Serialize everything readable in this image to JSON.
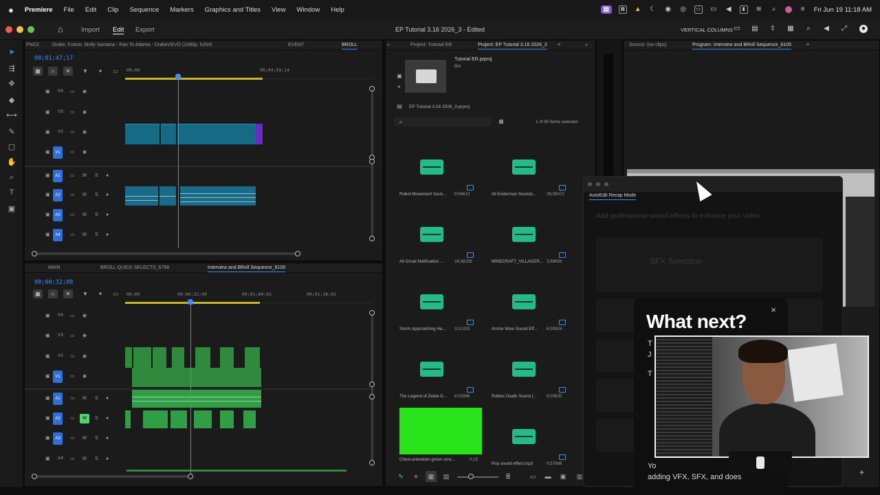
{
  "menubar": {
    "app": "Premiere",
    "items": [
      "File",
      "Edit",
      "Clip",
      "Sequence",
      "Markers",
      "Graphics and Titles",
      "View",
      "Window",
      "Help"
    ],
    "clock": "Fri Jun 19  11:18 AM"
  },
  "header": {
    "tabs": [
      "Import",
      "Edit",
      "Export"
    ],
    "active_tab": "Edit",
    "doc_title": "EP Tutorial 3.16 2026_3 - Edited",
    "workspace": "VERTICAL COLUMNS"
  },
  "top_timeline": {
    "tabs": [
      "PNG2",
      "Drake, Future, Molly Santana - Ran To Atlanta - DrakeVEVO (1080p, h264)",
      "EVENT",
      "BROLL"
    ],
    "active_tab": "BROLL",
    "timecode": "00;01;47;17",
    "ruler": [
      "00;00",
      "00;04;59;14"
    ],
    "tracks": [
      "V4",
      "V3",
      "V2",
      "V1",
      "A1",
      "A2",
      "A3",
      "A4"
    ]
  },
  "bottom_timeline": {
    "tabs": [
      "MAIN",
      "BROLL QUICK SELECTS_6758",
      "Interview and BRoll Sequence_8105"
    ],
    "active_tab": "Interview and BRoll Sequence_8105",
    "timecode": "00;00;32;00",
    "ruler": [
      "00;00",
      "00;00;32;00",
      "00;01;04;02",
      "00;01;36;02"
    ],
    "tracks": [
      "V4",
      "V3",
      "V2",
      "V1",
      "A1",
      "A2",
      "A3",
      "A4"
    ]
  },
  "project": {
    "tabs": [
      "Project: Tutorial ER",
      "Project: EP Tutorial 3.16 2026_3"
    ],
    "active_tab": "Project: EP Tutorial 3.16 2026_3",
    "bin_name": "Tutorial ER.prproj",
    "bin_type": "Bin",
    "path": "EP Tutorial 3.16 2026_3.prproj",
    "search_placeholder": "",
    "selection": "1 of 90 items selected",
    "assets": [
      {
        "name": "Robot Movement Soun...",
        "dur": "9;06612"
      },
      {
        "name": "All Enderman Sounds...",
        "dur": "26;09472"
      },
      {
        "name": "All Gmail Notification ...",
        "dur": "24;38256"
      },
      {
        "name": "MINECRAFT_VILLAGER...",
        "dur": "3;98656"
      },
      {
        "name": "Storm Approaching Ha...",
        "dur": "3;11328"
      },
      {
        "name": "Anime Wow Sound Eff...",
        "dur": "6;00824"
      },
      {
        "name": "The Legend of Zelda O...",
        "dur": "6;02866"
      },
      {
        "name": "Roblox Death Sound (...",
        "dur": "6;00830"
      },
      {
        "name": "Chest animation green scre...",
        "dur": "0;15"
      },
      {
        "name": "Pop sound effect.mp3",
        "dur": "0;57886"
      }
    ]
  },
  "monitor": {
    "tabs": [
      "Source: (no clips)",
      "Program: Interview and BRoll Sequence_8105"
    ],
    "active_tab": "Program: Interview and BRoll Sequence_8105"
  },
  "recap": {
    "tab": "AutoEdit Recap Mode",
    "faded_lines": [
      "Add professional sound effects to enhance your video",
      "SFX Selection"
    ]
  },
  "whatnext": {
    "title": "What next?",
    "lines": [
      "T",
      "J",
      "T",
      "Yo",
      "adding VFX, SFX, and does"
    ]
  },
  "colors": {
    "accent": "#3a8dff",
    "video_clip": "#156a86",
    "audio_green": "#2f9e45",
    "highlight": "#28e21a"
  }
}
